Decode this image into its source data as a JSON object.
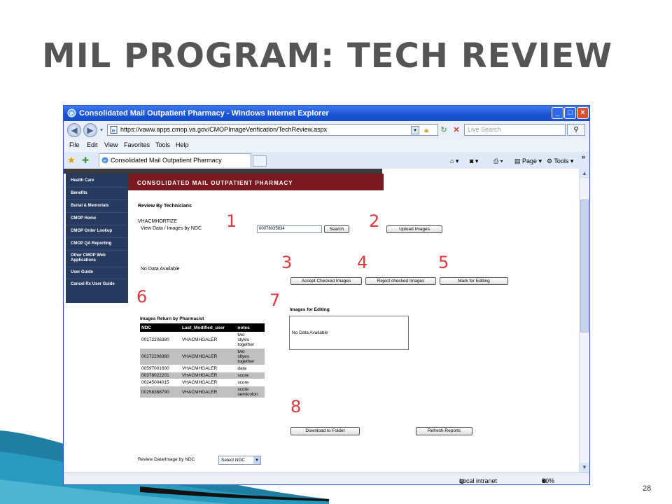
{
  "slide": {
    "title": "MIL PROGRAM: TECH REVIEW",
    "page_number": "28"
  },
  "window": {
    "title": "Consolidated Mail Outpatient Pharmacy - Windows Internet Explorer",
    "url": "https://vaww.apps.cmop.va.gov/CMOPImageVerification/TechReview.aspx",
    "search_placeholder": "Live Search",
    "menu": [
      "File",
      "Edit",
      "View",
      "Favorites",
      "Tools",
      "Help"
    ],
    "tab_title": "Consolidated Mail Outpatient Pharmacy",
    "cmd_page": "Page",
    "cmd_tools": "Tools",
    "status_zone": "Local intranet",
    "zoom": "80%"
  },
  "sidebar": {
    "items": [
      "Health Care",
      "Benefits",
      "Burial & Memorials",
      "CMOP Home",
      "CMOP Order Lookup",
      "CMOP QA Reporting",
      "Other CMOP Web Applications",
      "User Guide",
      "Cancel Rx User Guide"
    ]
  },
  "page": {
    "banner": "CONSOLIDATED MAIL OUTPATIENT PHARMACY",
    "heading": "Review By Technicians",
    "user": "VHACMHORTIZE",
    "view_label": "View Data / Images by NDC",
    "ndc_value": "00078035834",
    "search_label": "Search",
    "upload_label": "Upload Images",
    "no_data": "No Data Available",
    "accept_label": "Accept Checked Images",
    "reject_label": "Reject checked Images",
    "mark_label": "Mark for Editing",
    "returns_title": "Images Return by Pharmacist",
    "returns_columns": [
      "NDC",
      "Last_Modified_user",
      "notes"
    ],
    "returns_rows": [
      {
        "ndc": "00172208380",
        "user": "VHACMHGALER",
        "notes": [
          "two",
          "styles",
          "together"
        ]
      },
      {
        "ndc": "00172208380",
        "user": "VHACMHGALER",
        "notes": [
          "two",
          "stlyes",
          "together"
        ]
      },
      {
        "ndc": "00597001600",
        "user": "VHACMHGALER",
        "notes": [
          "data"
        ]
      },
      {
        "ndc": "00378022201",
        "user": "VHACMHGALER",
        "notes": [
          "score"
        ]
      },
      {
        "ndc": "00245004015",
        "user": "VHACMHGALER",
        "notes": [
          "score"
        ]
      },
      {
        "ndc": "00258368790",
        "user": "VHACMHGALER",
        "notes": [
          "score",
          "semicolon"
        ]
      }
    ],
    "editing_title": "Images for Editing",
    "editing_no_data": "No Data Available",
    "download_label": "Download to Folder",
    "refresh_label": "Refresh Reports",
    "review_label": "Review Data/Image by NDC",
    "select_ndc": "Select NDC"
  },
  "callouts": [
    "1",
    "2",
    "3",
    "4",
    "5",
    "6",
    "7",
    "8"
  ],
  "colors": {
    "callout": "#e0363f",
    "banner": "#7a1a20",
    "sidebar": "#273b5e",
    "titlebar": "#1a52d6"
  }
}
